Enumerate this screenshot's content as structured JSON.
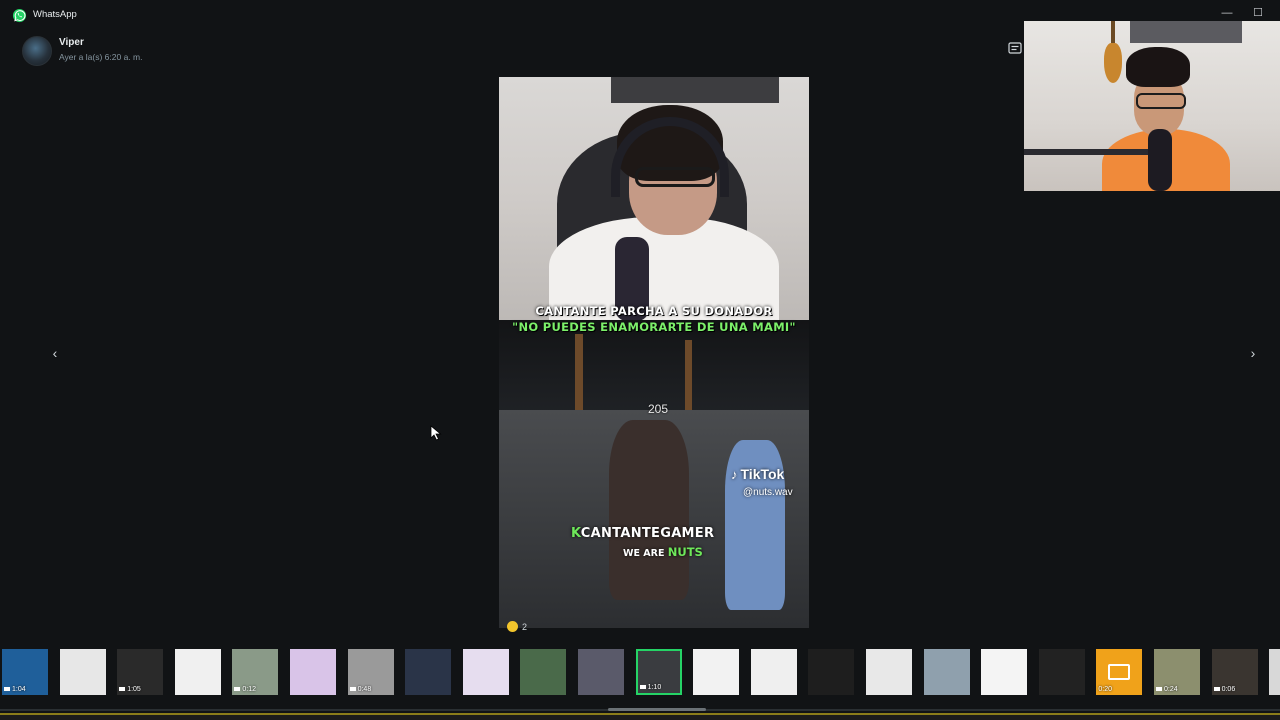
{
  "window": {
    "app_title": "WhatsApp",
    "minimize_glyph": "—",
    "maximize_glyph": "☐"
  },
  "sender": {
    "name": "Viper",
    "timestamp": "Ayer a la(s) 6:20 a. m."
  },
  "media": {
    "headline": "CANTANTE PARCHA A SU DONADOR",
    "quote": "\"NO PUEDES ENAMORARTE DE UNA MAMI\"",
    "count_overlay": "205",
    "platform": "TikTok",
    "handle": "@nuts.wav",
    "brand_k": "K",
    "brand_name": "CANTANTEGAMER",
    "tagline_prefix": "WE ARE",
    "tagline_highlight": "NUTS"
  },
  "reaction": {
    "count": "2",
    "color": "#f3c52c"
  },
  "navigation": {
    "prev_glyph": "‹",
    "next_glyph": "›"
  },
  "icons": {
    "app_logo": "whatsapp-icon",
    "caption": "caption-icon",
    "cursor": "cursor-icon"
  },
  "colors": {
    "accent": "#25d366",
    "background": "#111315",
    "text": "#e9edef",
    "muted": "#8696a0"
  },
  "thumbnails": [
    {
      "duration": "1:04",
      "video": true,
      "color": "#1f5f9a",
      "selected": false
    },
    {
      "duration": "",
      "video": false,
      "color": "#e7e7e7",
      "selected": false
    },
    {
      "duration": "1:05",
      "video": true,
      "color": "#2a2a2a",
      "selected": false
    },
    {
      "duration": "",
      "video": false,
      "color": "#f0f0f0",
      "selected": false
    },
    {
      "duration": "0:12",
      "video": true,
      "color": "#8a9a88",
      "selected": false
    },
    {
      "duration": "",
      "video": false,
      "color": "#d9c4e8",
      "selected": false
    },
    {
      "duration": "0:48",
      "video": true,
      "color": "#9a9a9a",
      "selected": false
    },
    {
      "duration": "",
      "video": false,
      "color": "#2a3448",
      "selected": false
    },
    {
      "duration": "",
      "video": false,
      "color": "#e6ddef",
      "selected": false
    },
    {
      "duration": "",
      "video": false,
      "color": "#4a6a4a",
      "selected": false
    },
    {
      "duration": "",
      "video": false,
      "color": "#5a5a6a",
      "selected": false
    },
    {
      "duration": "1:10",
      "video": true,
      "color": "#3a3c40",
      "selected": true
    },
    {
      "duration": "",
      "video": false,
      "color": "#f2f2f2",
      "selected": false
    },
    {
      "duration": "",
      "video": false,
      "color": "#efefef",
      "selected": false
    },
    {
      "duration": "",
      "video": false,
      "color": "#1e1e1e",
      "selected": false
    },
    {
      "duration": "",
      "video": false,
      "color": "#e8e8e8",
      "selected": false
    },
    {
      "duration": "",
      "video": false,
      "color": "#8fa0ad",
      "selected": false
    },
    {
      "duration": "",
      "video": false,
      "color": "#f4f4f4",
      "selected": false
    },
    {
      "duration": "",
      "video": false,
      "color": "#222222",
      "selected": false
    },
    {
      "duration": "0:20",
      "video": false,
      "color": "#f0a21a",
      "selected": false,
      "image_placeholder": true
    },
    {
      "duration": "0:24",
      "video": true,
      "color": "#8c8f6e",
      "selected": false
    },
    {
      "duration": "0:06",
      "video": true,
      "color": "#3a3530",
      "selected": false
    },
    {
      "duration": "",
      "video": false,
      "color": "#d8d8d8",
      "selected": false
    }
  ]
}
